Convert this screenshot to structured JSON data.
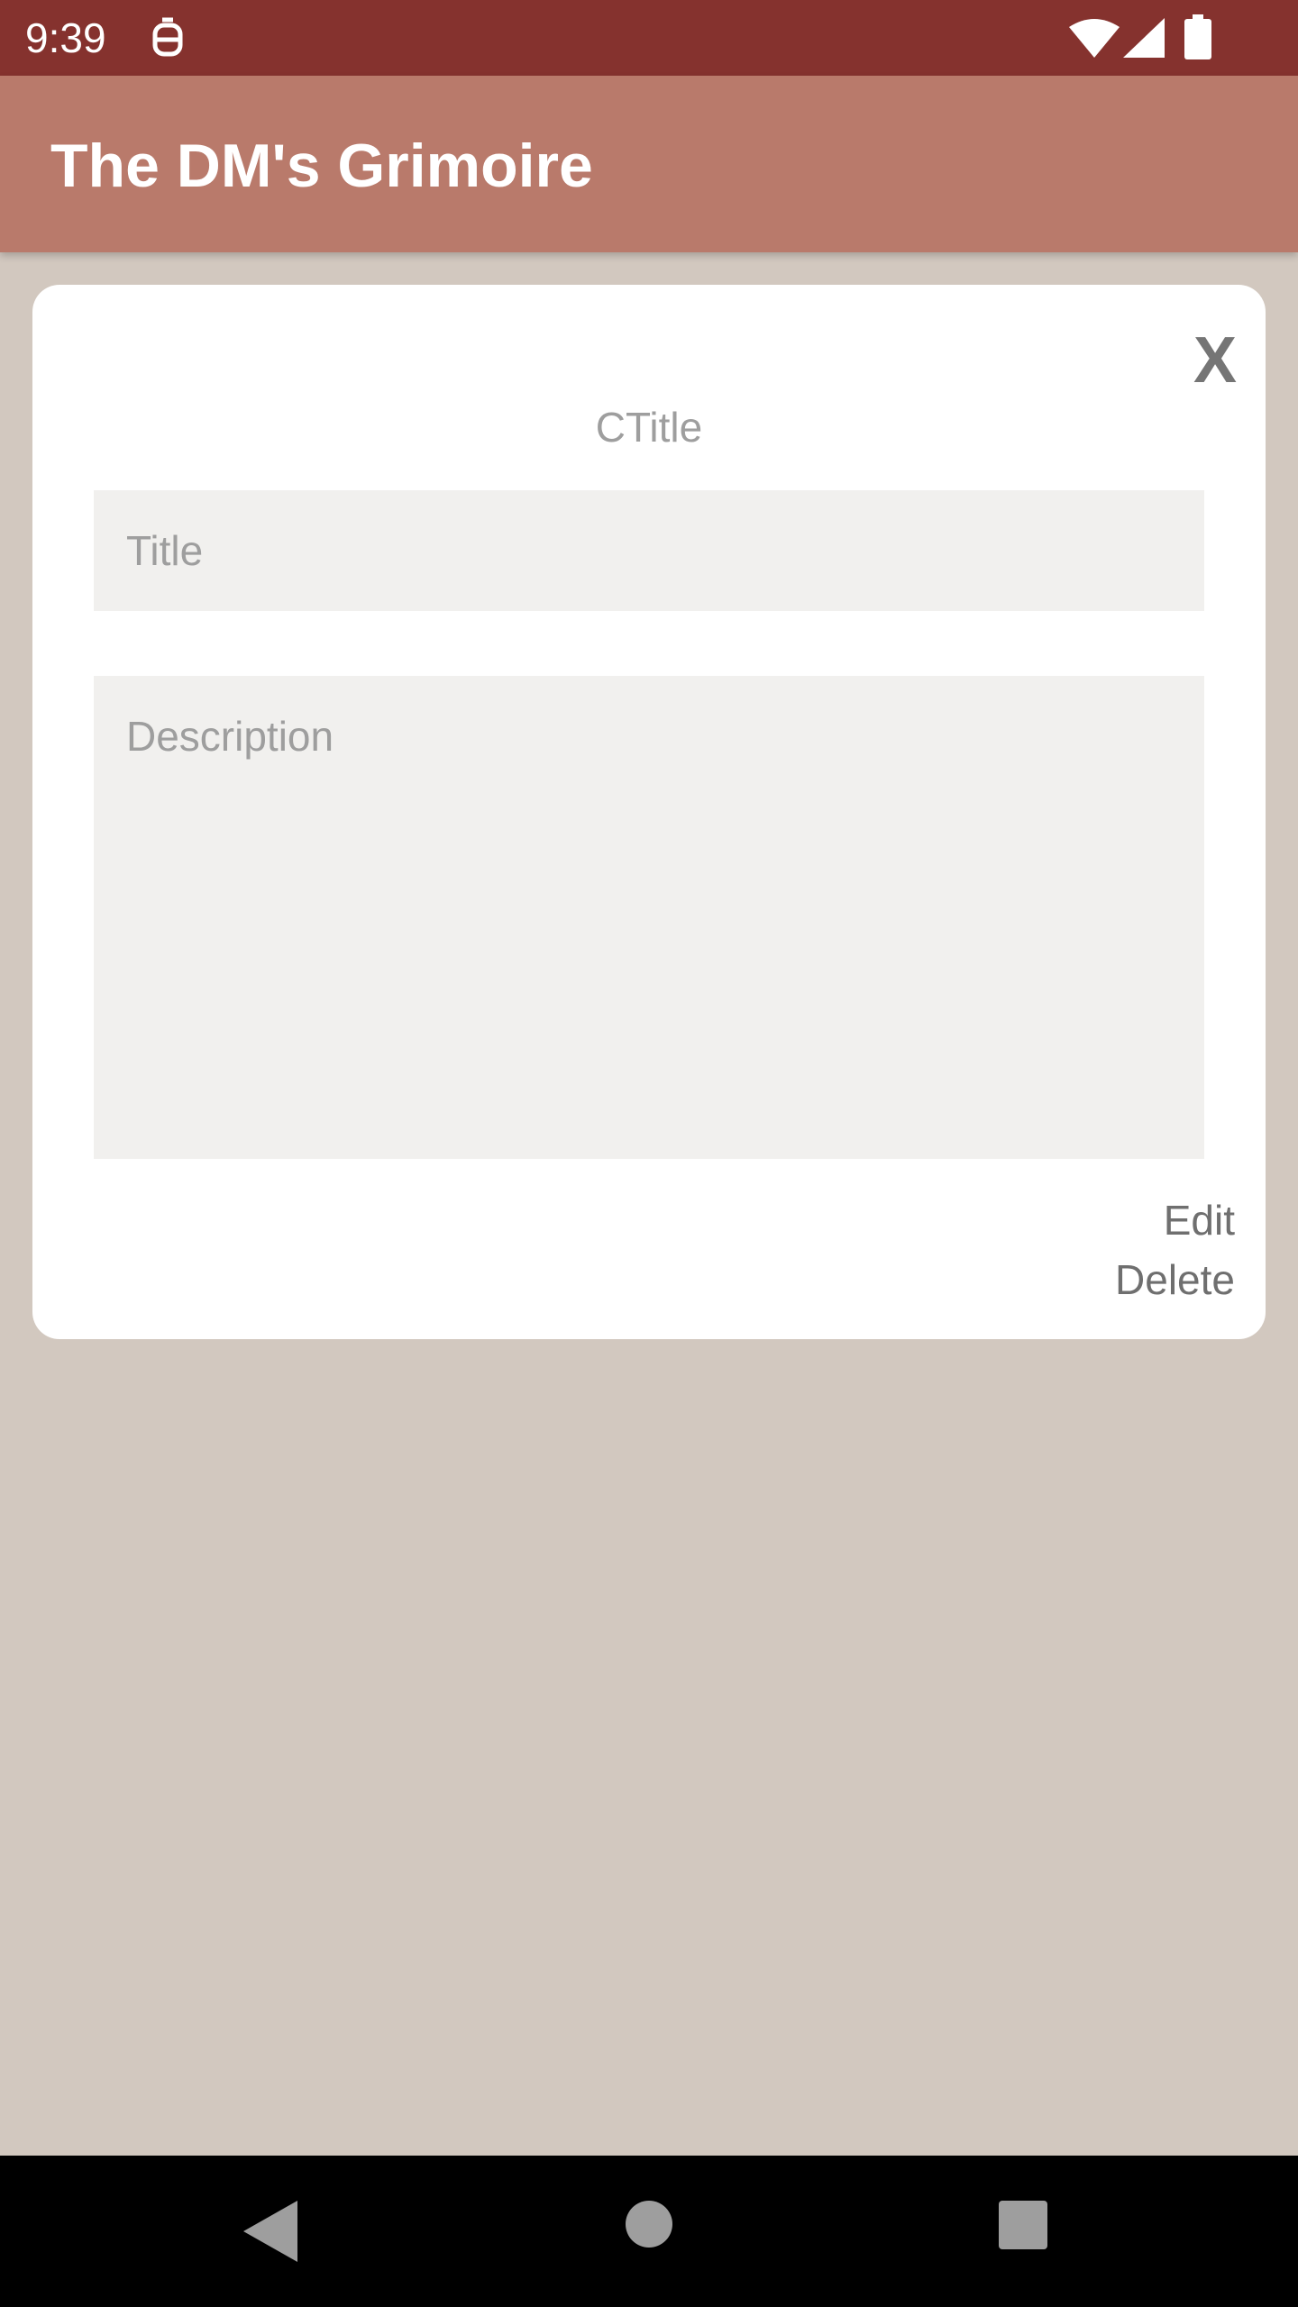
{
  "status_bar": {
    "time": "9:39",
    "icons": [
      "notification-icon",
      "wifi-icon",
      "signal-icon",
      "battery-icon"
    ]
  },
  "app_bar": {
    "title": "The DM's Grimoire"
  },
  "card": {
    "close_label": "X",
    "heading": "CTitle",
    "title_placeholder": "Title",
    "title_value": "",
    "description_placeholder": "Description",
    "description_value": "",
    "edit_label": "Edit",
    "delete_label": "Delete"
  },
  "nav_bar": {
    "icons": [
      "back-icon",
      "home-icon",
      "recents-icon"
    ]
  },
  "colors": {
    "status_bar": "#85322e",
    "app_bar": "#b97a6b",
    "background": "#d2c8bf",
    "card": "#ffffff",
    "field": "#f1f0ee"
  }
}
